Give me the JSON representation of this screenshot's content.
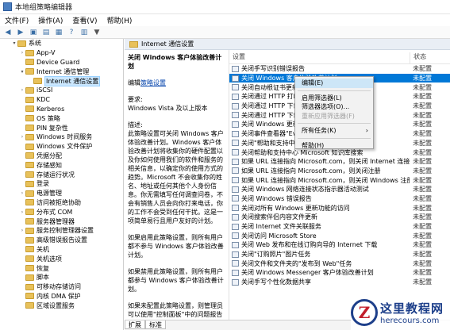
{
  "window": {
    "title": "本地组策略编辑器"
  },
  "menubar": [
    "文件(F)",
    "操作(A)",
    "查看(V)",
    "帮助(H)"
  ],
  "tree": [
    {
      "label": "系统",
      "indent": 1,
      "arrow": "▾"
    },
    {
      "label": "App-V",
      "indent": 2,
      "arrow": "›"
    },
    {
      "label": "Device Guard",
      "indent": 2,
      "arrow": ""
    },
    {
      "label": "Internet 通信管理",
      "indent": 2,
      "arrow": "▾"
    },
    {
      "label": "Internet 通信设置",
      "indent": 3,
      "arrow": "",
      "selected": true
    },
    {
      "label": "iSCSI",
      "indent": 2,
      "arrow": "›"
    },
    {
      "label": "KDC",
      "indent": 2,
      "arrow": ""
    },
    {
      "label": "Kerberos",
      "indent": 2,
      "arrow": ""
    },
    {
      "label": "OS 策略",
      "indent": 2,
      "arrow": ""
    },
    {
      "label": "PIN 复杂性",
      "indent": 2,
      "arrow": ""
    },
    {
      "label": "Windows 时间服务",
      "indent": 2,
      "arrow": "›"
    },
    {
      "label": "Windows 文件保护",
      "indent": 2,
      "arrow": ""
    },
    {
      "label": "凭据分配",
      "indent": 2,
      "arrow": ""
    },
    {
      "label": "存储感知",
      "indent": 2,
      "arrow": ""
    },
    {
      "label": "存储运行状况",
      "indent": 2,
      "arrow": ""
    },
    {
      "label": "登录",
      "indent": 2,
      "arrow": ""
    },
    {
      "label": "电源管理",
      "indent": 2,
      "arrow": "›"
    },
    {
      "label": "访问被拒绝协助",
      "indent": 2,
      "arrow": ""
    },
    {
      "label": "分布式 COM",
      "indent": 2,
      "arrow": "›"
    },
    {
      "label": "服务器管理器",
      "indent": 2,
      "arrow": ""
    },
    {
      "label": "服务控制管理器设置",
      "indent": 2,
      "arrow": "›"
    },
    {
      "label": "高级错误报告设置",
      "indent": 2,
      "arrow": ""
    },
    {
      "label": "关机",
      "indent": 2,
      "arrow": ""
    },
    {
      "label": "关机选项",
      "indent": 2,
      "arrow": ""
    },
    {
      "label": "恢复",
      "indent": 2,
      "arrow": ""
    },
    {
      "label": "脚本",
      "indent": 2,
      "arrow": ""
    },
    {
      "label": "可移动存储访问",
      "indent": 2,
      "arrow": ""
    },
    {
      "label": "内核 DMA 保护",
      "indent": 2,
      "arrow": ""
    },
    {
      "label": "区域设置服务",
      "indent": 2,
      "arrow": ""
    }
  ],
  "pane": {
    "header": "Internet 通信设置",
    "desc_title": "关闭 Windows 客户体验改善计划",
    "edit_prefix": "编辑",
    "edit_link": "策略设置",
    "requirements_label": "要求:",
    "requirements": "Windows Vista 及以上版本",
    "description_label": "描述:",
    "description": "此策略设置可关闭 Windows 客户体验改善计划。Windows 客户体验改善计划将收集你的硬件配置以及你如何使用我们的软件和服务的相关信息，以确定你的使用方式的趋势。Microsoft 不会收集你的姓名、地址或任何其他个人身份信息。你无需填写任何调查问卷，不会有销售人员会向你打来电话，你的工作不会受到任何干扰。这是一项简单易行且用户友好的计划。",
    "desc_enabled": "如果启用此策略设置，则所有用户都不参与 Windows 客户体验改善计划。",
    "desc_disabled": "如果禁用此策略设置，则所有用户都参与 Windows 客户体验改善计划。",
    "desc_notconfigured": "如果未配置此策略设置，则管理员可以使用\"控制面板\"中的问题报告和解决方案\"组件为所有用户启用 Windows 客户体验改善计划。"
  },
  "list": {
    "col_setting": "设置",
    "col_state": "状态",
    "rows": [
      {
        "setting": "关闭手写识别错误报告",
        "state": "未配置"
      },
      {
        "setting": "关闭 Windows 客户体验改善计划",
        "state": "未配置",
        "selected": true
      },
      {
        "setting": "关闭自动根证书更新",
        "state": "未配置"
      },
      {
        "setting": "关闭通过 HTTP 打印",
        "state": "未配置"
      },
      {
        "setting": "关闭通过 HTTP 下载打印机驱动程序",
        "state": "未配置"
      },
      {
        "setting": "关闭通过 HTTP 下载打印机驱动程序",
        "state": "未配置"
      },
      {
        "setting": "关闭 Windows 更新设备驱动程序搜索",
        "state": "未配置"
      },
      {
        "setting": "关闭事件查看器\"Events.asp\"链接",
        "state": "未配置"
      },
      {
        "setting": "关闭\"帮助和支持中心\"\"你知道吗?\"内容",
        "state": "未配置"
      },
      {
        "setting": "关闭帮助和支持中心 Microsoft 知识库搜索",
        "state": "未配置"
      },
      {
        "setting": "如果 URL 连接指向 Microsoft.com，则关闭 Internet 连接向导",
        "state": "未配置"
      },
      {
        "setting": "如果 URL 连接指向 Microsoft.com，则关闭注册",
        "state": "未配置"
      },
      {
        "setting": "如果 URL 连接指向 Microsoft.com，则关闭 Windows 注册",
        "state": "未配置"
      },
      {
        "setting": "关闭 Windows 网络连接状态指示器活动测试",
        "state": "未配置"
      },
      {
        "setting": "关闭 Windows 错误报告",
        "state": "未配置"
      },
      {
        "setting": "关闭对所有 Windows 更新功能的访问",
        "state": "未配置"
      },
      {
        "setting": "关闭搜索伴侣内容文件更新",
        "state": "未配置"
      },
      {
        "setting": "关闭 Internet 文件关联服务",
        "state": "未配置"
      },
      {
        "setting": "关闭访问 Microsoft Store",
        "state": "未配置"
      },
      {
        "setting": "关闭 Web 发布和在线订购向导的 Internet 下载",
        "state": "未配置"
      },
      {
        "setting": "关闭\"订购照片\"图片任务",
        "state": "未配置"
      },
      {
        "setting": "关闭文件和文件夹的\"发布到 Web\"任务",
        "state": "未配置"
      },
      {
        "setting": "关闭 Windows Messenger 客户体验改善计划",
        "state": "未配置"
      },
      {
        "setting": "关闭手写个性化数据共享",
        "state": "未配置"
      }
    ]
  },
  "tabs": [
    "扩展",
    "标准"
  ],
  "context_menu": {
    "items": [
      {
        "label": "编辑(E)",
        "highlight": true
      },
      {
        "label": "启用筛选器(L)"
      },
      {
        "label": "筛选器选项(O)..."
      },
      {
        "label": "重新应用筛选器(F)",
        "disabled": true
      },
      {
        "label": "所有任务(K)",
        "submenu": true
      },
      {
        "label": "帮助(H)"
      }
    ]
  },
  "watermark": {
    "logo_letter": "Z",
    "cn": "这里教程网",
    "url": "herecours.com"
  }
}
